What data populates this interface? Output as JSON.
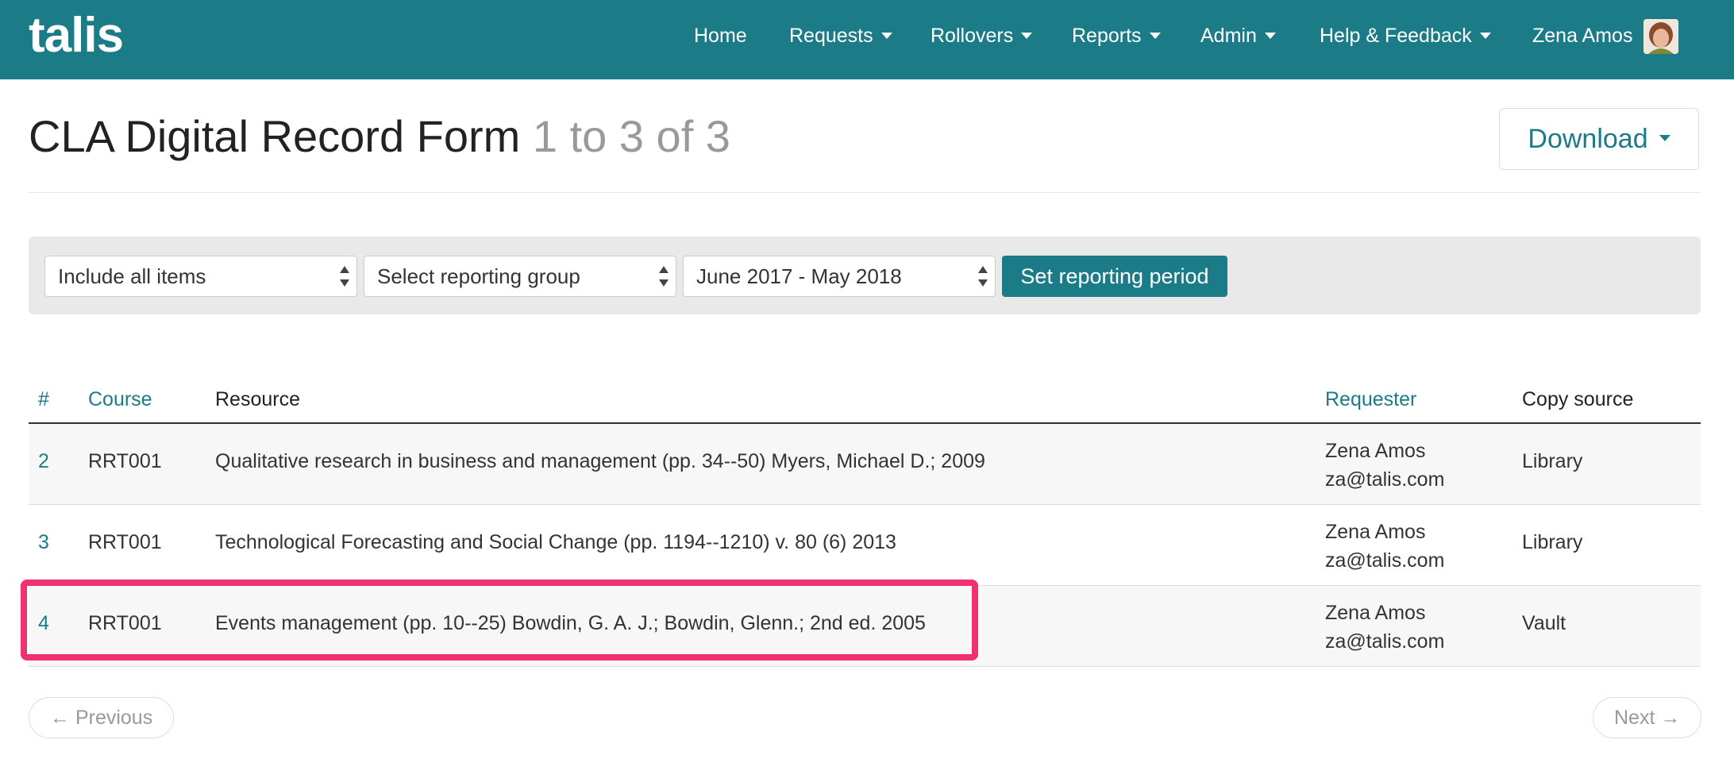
{
  "nav": {
    "brand": "talis",
    "items": [
      {
        "label": "Home"
      },
      {
        "label": "Requests"
      },
      {
        "label": "Rollovers"
      },
      {
        "label": "Reports"
      },
      {
        "label": "Admin"
      },
      {
        "label": "Help & Feedback"
      },
      {
        "label": "Zena Amos"
      }
    ],
    "avatar_icon": "user-avatar"
  },
  "header": {
    "title": "CLA Digital Record Form",
    "count": "1 to 3 of 3",
    "download_label": "Download"
  },
  "filters": {
    "items": "Include all items",
    "group": "Select reporting group",
    "period": "June 2017 - May 2018",
    "set_label": "Set reporting period"
  },
  "table": {
    "headers": {
      "num": "#",
      "course": "Course",
      "resource": "Resource",
      "requester": "Requester",
      "source": "Copy source"
    },
    "rows": [
      {
        "num": "2",
        "course": "RRT001",
        "resource": "Qualitative research in business and management (pp. 34--50) Myers, Michael D.; 2009",
        "requester_name": "Zena Amos",
        "requester_email": "za@talis.com",
        "source": "Library"
      },
      {
        "num": "3",
        "course": "RRT001",
        "resource": "Technological Forecasting and Social Change (pp. 1194--1210) v. 80 (6) 2013",
        "requester_name": "Zena Amos",
        "requester_email": "za@talis.com",
        "source": "Library"
      },
      {
        "num": "4",
        "course": "RRT001",
        "resource": "Events management (pp. 10--25) Bowdin, G. A. J.; Bowdin, Glenn.; 2nd ed. 2005",
        "requester_name": "Zena Amos",
        "requester_email": "za@talis.com",
        "source": "Vault"
      }
    ]
  },
  "pager": {
    "previous": "← Previous",
    "next": "Next →"
  },
  "colors": {
    "brand": "#1b7b87",
    "highlight": "#f0306f"
  }
}
